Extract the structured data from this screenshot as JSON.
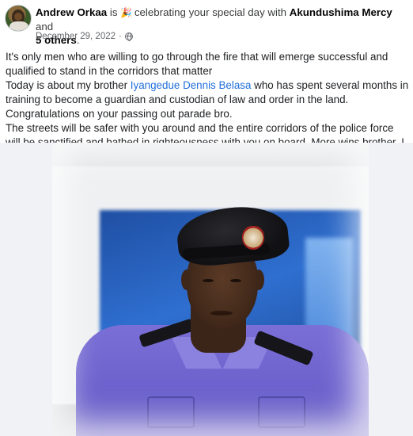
{
  "post": {
    "author": "Andrew Orkaa",
    "is_text": "is",
    "activity_icon": "party-popper-icon",
    "activity_text": "celebrating your special day with",
    "tagged_user": "Akundushima Mercy",
    "and_text": "and",
    "others_text": "5 others",
    "period": ".",
    "date": "December 29, 2022",
    "separator": "·",
    "privacy_icon": "globe-icon",
    "body": {
      "line1": "It's only men who are willing to go through the fire that will emerge successful and qualified to stand in the corridors that matter",
      "line2_prefix": "Today is about my brother ",
      "line2_mention": "Iyangedue Dennis Belasa",
      "line2_suffix": " who has spent several months in training to become a guardian and custodian of law and order in the land.",
      "line3": "Congratulations on your passing out parade bro.",
      "line4": "The streets will be safer with you around and the entire corridors of the police force will be sanctified and bathed in righteousness with you on board. More wins brother. I am proud of you"
    }
  }
}
